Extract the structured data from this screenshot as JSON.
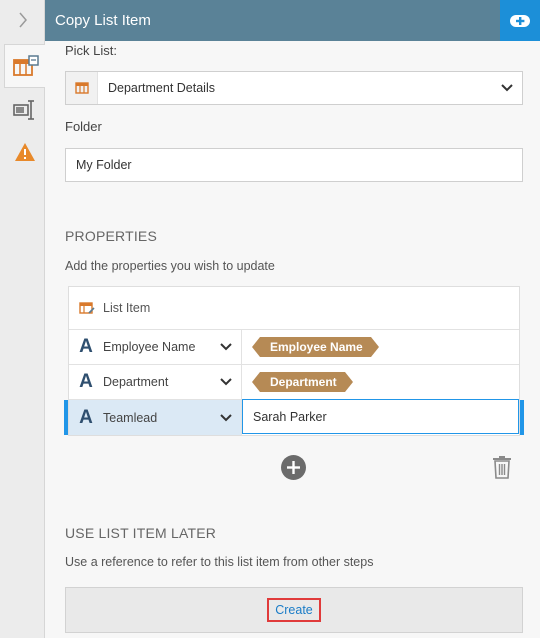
{
  "header": {
    "title": "Copy List Item"
  },
  "pick_list": {
    "label": "Pick List:",
    "value": "Department Details"
  },
  "folder": {
    "label": "Folder",
    "value": "My Folder"
  },
  "properties": {
    "heading": "PROPERTIES",
    "description": "Add the properties you wish to update",
    "table_header": "List Item",
    "rows": [
      {
        "name": "Employee Name",
        "value": "Employee Name",
        "value_type": "token"
      },
      {
        "name": "Department",
        "value": "Department",
        "value_type": "token"
      },
      {
        "name": "Teamlead",
        "value": "Sarah Parker",
        "value_type": "text"
      }
    ]
  },
  "use_later": {
    "heading": "USE LIST ITEM LATER",
    "description": "Use a reference to refer to this list item from other steps",
    "create_label": "Create"
  },
  "icons": {
    "rail": [
      "chevron-right-icon",
      "list-item-icon",
      "properties-icon",
      "warning-icon"
    ],
    "header_button": "add-icon",
    "property_type": "text-type-icon"
  },
  "colors": {
    "header": "#5a8297",
    "accent": "#1c8fd8",
    "token": "#b68a55",
    "warning": "#e8892a",
    "list_icon": "#d9792b",
    "highlight_box": "#e03a3a"
  }
}
